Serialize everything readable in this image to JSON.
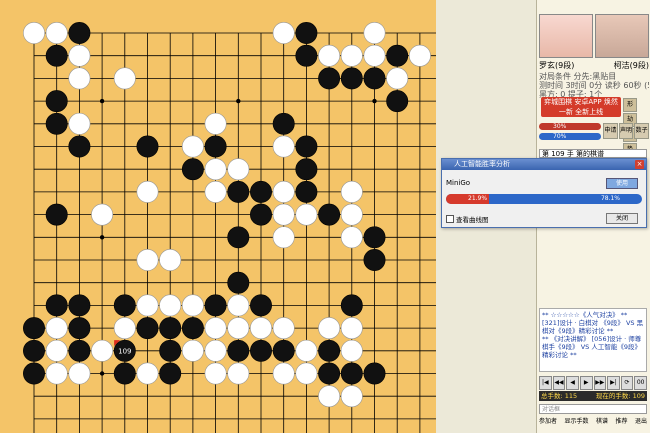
{
  "board": {
    "size": 19,
    "stones": [
      [
        "W",
        0,
        0
      ],
      [
        "W",
        1,
        0
      ],
      [
        "B",
        2,
        0
      ],
      [
        "W",
        11,
        0
      ],
      [
        "B",
        12,
        0
      ],
      [
        "W",
        15,
        0
      ],
      [
        "B",
        1,
        1
      ],
      [
        "W",
        2,
        1
      ],
      [
        "B",
        12,
        1
      ],
      [
        "W",
        13,
        1
      ],
      [
        "W",
        14,
        1
      ],
      [
        "W",
        15,
        1
      ],
      [
        "B",
        16,
        1
      ],
      [
        "W",
        17,
        1
      ],
      [
        "W",
        2,
        2
      ],
      [
        "W",
        4,
        2
      ],
      [
        "B",
        13,
        2
      ],
      [
        "B",
        14,
        2
      ],
      [
        "B",
        15,
        2
      ],
      [
        "W",
        16,
        2
      ],
      [
        "B",
        1,
        3
      ],
      [
        "B",
        16,
        3
      ],
      [
        "B",
        1,
        4
      ],
      [
        "W",
        2,
        4
      ],
      [
        "W",
        8,
        4
      ],
      [
        "B",
        11,
        4
      ],
      [
        "B",
        2,
        5
      ],
      [
        "B",
        5,
        5
      ],
      [
        "W",
        7,
        5
      ],
      [
        "B",
        8,
        5
      ],
      [
        "W",
        11,
        5
      ],
      [
        "B",
        12,
        5
      ],
      [
        "B",
        7,
        6
      ],
      [
        "W",
        8,
        6
      ],
      [
        "W",
        9,
        6
      ],
      [
        "B",
        12,
        6
      ],
      [
        "W",
        5,
        7
      ],
      [
        "W",
        8,
        7
      ],
      [
        "B",
        9,
        7
      ],
      [
        "B",
        10,
        7
      ],
      [
        "W",
        11,
        7
      ],
      [
        "B",
        12,
        7
      ],
      [
        "W",
        14,
        7
      ],
      [
        "B",
        1,
        8
      ],
      [
        "W",
        3,
        8
      ],
      [
        "B",
        10,
        8
      ],
      [
        "W",
        11,
        8
      ],
      [
        "W",
        12,
        8
      ],
      [
        "B",
        13,
        8
      ],
      [
        "W",
        14,
        8
      ],
      [
        "B",
        9,
        9
      ],
      [
        "W",
        11,
        9
      ],
      [
        "W",
        14,
        9
      ],
      [
        "B",
        15,
        9
      ],
      [
        "W",
        5,
        10
      ],
      [
        "W",
        6,
        10
      ],
      [
        "B",
        15,
        10
      ],
      [
        "B",
        9,
        11
      ],
      [
        "B",
        1,
        12
      ],
      [
        "B",
        2,
        12
      ],
      [
        "B",
        4,
        12
      ],
      [
        "W",
        5,
        12
      ],
      [
        "W",
        6,
        12
      ],
      [
        "W",
        7,
        12
      ],
      [
        "B",
        8,
        12
      ],
      [
        "W",
        9,
        12
      ],
      [
        "B",
        10,
        12
      ],
      [
        "B",
        14,
        12
      ],
      [
        "B",
        0,
        13
      ],
      [
        "W",
        1,
        13
      ],
      [
        "B",
        2,
        13
      ],
      [
        "W",
        4,
        13
      ],
      [
        "B",
        5,
        13
      ],
      [
        "B",
        6,
        13
      ],
      [
        "B",
        7,
        13
      ],
      [
        "W",
        8,
        13
      ],
      [
        "W",
        9,
        13
      ],
      [
        "W",
        10,
        13
      ],
      [
        "W",
        11,
        13
      ],
      [
        "W",
        13,
        13
      ],
      [
        "W",
        14,
        13
      ],
      [
        "B",
        0,
        14
      ],
      [
        "W",
        1,
        14
      ],
      [
        "B",
        2,
        14
      ],
      [
        "W",
        3,
        14
      ],
      [
        "B",
        4,
        14
      ],
      [
        "B",
        6,
        14
      ],
      [
        "W",
        7,
        14
      ],
      [
        "W",
        8,
        14
      ],
      [
        "B",
        9,
        14
      ],
      [
        "B",
        10,
        14
      ],
      [
        "B",
        11,
        14
      ],
      [
        "W",
        12,
        14
      ],
      [
        "B",
        13,
        14
      ],
      [
        "W",
        14,
        14
      ],
      [
        "B",
        0,
        15
      ],
      [
        "W",
        1,
        15
      ],
      [
        "W",
        2,
        15
      ],
      [
        "B",
        4,
        15
      ],
      [
        "W",
        5,
        15
      ],
      [
        "B",
        6,
        15
      ],
      [
        "W",
        8,
        15
      ],
      [
        "W",
        9,
        15
      ],
      [
        "W",
        11,
        15
      ],
      [
        "W",
        12,
        15
      ],
      [
        "B",
        13,
        15
      ],
      [
        "B",
        14,
        15
      ],
      [
        "B",
        15,
        15
      ],
      [
        "W",
        13,
        16
      ],
      [
        "W",
        14,
        16
      ]
    ],
    "last_move": {
      "x": 4,
      "y": 14,
      "label": "109"
    }
  },
  "players": {
    "black_name": "罗玄(9段)",
    "white_name": "柯洁(9段)"
  },
  "game_info": {
    "line1": "对局条件          分先:黑贴目",
    "line2": "测时间  3时间 0分 读秒 60秒 (5次)",
    "line3": "黑方: 0         提子:  1个"
  },
  "banner_text": "弈城围棋 安卓APP 焕然一新 全新上线",
  "side_buttons": [
    "形",
    "劫",
    "点",
    "势"
  ],
  "time": {
    "black": "30%",
    "white": "70%"
  },
  "move_info": "第 109 手 第的棋谱",
  "action_buttons": [
    "申请",
    "声明",
    "数子"
  ],
  "chat_lines": [
    "** ☆☆☆☆☆《人气对决》 **",
    "[321]设计 · 白棋对 《9段》 VS 黑棋对《9段》精彩讨论 **",
    "** 《对决讲解》 [056]设计 · 师尊棋手《9段》 VS 人工智能《9段》精彩讨论 **"
  ],
  "nav_buttons": [
    "|◀",
    "◀◀",
    "◀",
    "▶",
    "▶▶",
    "▶|",
    "⟳",
    "00"
  ],
  "counts": {
    "left": "总手数: 115",
    "right": "现在的手数: 109"
  },
  "input_placeholder": "对话框",
  "bottom_nav": [
    "参加者",
    "显示手数",
    "棋谱",
    "推荐",
    "退出"
  ],
  "dialog": {
    "title": "人工智能胜率分析",
    "engine": "MiniGo",
    "switch_label": "使用",
    "black_pct": 21.9,
    "black_label": "21.9%",
    "white_label": "78.1%",
    "checkbox_label": "查看曲线图",
    "ok_label": "关闭"
  }
}
